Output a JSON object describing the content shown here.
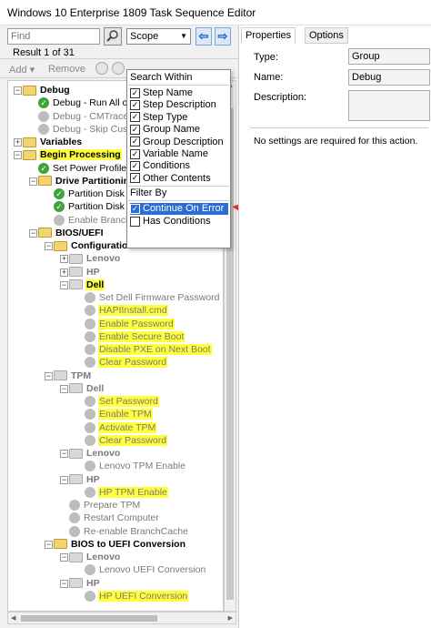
{
  "window": {
    "title": "Windows 10 Enterprise 1809 Task Sequence Editor"
  },
  "search": {
    "placeholder": "Find",
    "scope_label": "Scope",
    "result": "Result 1 of 31"
  },
  "toolbar": {
    "add_label": "Add",
    "remove_label": "Remove"
  },
  "scope_menu": {
    "search_within_header": "Search Within",
    "search_within": [
      {
        "label": "Step Name",
        "checked": true
      },
      {
        "label": "Step Description",
        "checked": true
      },
      {
        "label": "Step Type",
        "checked": true
      },
      {
        "label": "Group Name",
        "checked": true
      },
      {
        "label": "Group Description",
        "checked": true
      },
      {
        "label": "Variable Name",
        "checked": true
      },
      {
        "label": "Conditions",
        "checked": true
      },
      {
        "label": "Other Contents",
        "checked": true
      }
    ],
    "filter_by_header": "Filter By",
    "filter_by": [
      {
        "label": "Continue On Error",
        "checked": true,
        "selected": true
      },
      {
        "label": "Has Conditions",
        "checked": false,
        "selected": false
      }
    ]
  },
  "tree": [
    {
      "label": "Debug",
      "kind": "group",
      "level": 0,
      "exp": "-"
    },
    {
      "label": "Debug - Run All or",
      "kind": "ok",
      "level": 1
    },
    {
      "label": "Debug - CMTrace",
      "kind": "off",
      "level": 1
    },
    {
      "label": "Debug - Skip Cust",
      "kind": "off",
      "level": 1
    },
    {
      "label": "Variables",
      "kind": "group",
      "level": 0,
      "exp": "+"
    },
    {
      "label": "Begin Processing",
      "kind": "group",
      "level": 0,
      "exp": "-",
      "hl": true
    },
    {
      "label": "Set Power Profile t",
      "kind": "ok",
      "level": 1
    },
    {
      "label": "Drive Partitionin",
      "kind": "group",
      "level": 1,
      "exp": "-"
    },
    {
      "label": "Partition Disk 0",
      "kind": "ok",
      "level": 2
    },
    {
      "label": "Partition Disk 0",
      "kind": "ok",
      "level": 2
    },
    {
      "label": "Enable Branch",
      "kind": "off",
      "level": 2
    },
    {
      "label": "BIOS/UEFI",
      "kind": "group",
      "level": 1,
      "exp": "-"
    },
    {
      "label": "Configuration",
      "kind": "group",
      "level": 2,
      "exp": "-"
    },
    {
      "label": "Lenovo",
      "kind": "dgroup",
      "level": 3,
      "exp": "+"
    },
    {
      "label": "HP",
      "kind": "dgroup",
      "level": 3,
      "exp": "+"
    },
    {
      "label": "Dell",
      "kind": "dgroup",
      "level": 3,
      "exp": "-",
      "hl": true
    },
    {
      "label": "Set Dell Firmware Password",
      "kind": "off",
      "level": 4
    },
    {
      "label": "HAPIInstall.cmd",
      "kind": "off",
      "level": 4,
      "hl": true
    },
    {
      "label": "Enable Password",
      "kind": "off",
      "level": 4,
      "hl": true
    },
    {
      "label": "Enable Secure Boot",
      "kind": "off",
      "level": 4,
      "hl": true
    },
    {
      "label": "Disable PXE on Next Boot",
      "kind": "off",
      "level": 4,
      "hl": true
    },
    {
      "label": "Clear Password",
      "kind": "off",
      "level": 4,
      "hl": true
    },
    {
      "label": "TPM",
      "kind": "dgroup",
      "level": 2,
      "exp": "-"
    },
    {
      "label": "Dell",
      "kind": "dgroup",
      "level": 3,
      "exp": "-"
    },
    {
      "label": "Set Password",
      "kind": "off",
      "level": 4,
      "hl": true
    },
    {
      "label": "Enable TPM",
      "kind": "off",
      "level": 4,
      "hl": true
    },
    {
      "label": "Activate TPM",
      "kind": "off",
      "level": 4,
      "hl": true
    },
    {
      "label": "Clear Password",
      "kind": "off",
      "level": 4,
      "hl": true
    },
    {
      "label": "Lenovo",
      "kind": "dgroup",
      "level": 3,
      "exp": "-"
    },
    {
      "label": "Lenovo TPM Enable",
      "kind": "off",
      "level": 4
    },
    {
      "label": "HP",
      "kind": "dgroup",
      "level": 3,
      "exp": "-"
    },
    {
      "label": "HP TPM Enable",
      "kind": "off",
      "level": 4,
      "hl": true
    },
    {
      "label": "Prepare TPM",
      "kind": "off",
      "level": 3
    },
    {
      "label": "Restart Computer",
      "kind": "off",
      "level": 3
    },
    {
      "label": "Re-enable BranchCache",
      "kind": "off",
      "level": 3
    },
    {
      "label": "BIOS to UEFI Conversion",
      "kind": "group",
      "level": 2,
      "exp": "-"
    },
    {
      "label": "Lenovo",
      "kind": "dgroup",
      "level": 3,
      "exp": "-"
    },
    {
      "label": "Lenovo UEFI Conversion",
      "kind": "off",
      "level": 4
    },
    {
      "label": "HP",
      "kind": "dgroup",
      "level": 3,
      "exp": "-"
    },
    {
      "label": "HP UEFI Conversion",
      "kind": "off",
      "level": 4,
      "hl": true
    }
  ],
  "tabs": [
    {
      "label": "Properties",
      "active": true
    },
    {
      "label": "Options",
      "active": false
    }
  ],
  "properties": {
    "type_label": "Type:",
    "type_value": "Group",
    "name_label": "Name:",
    "name_value": "Debug",
    "description_label": "Description:",
    "description_value": "",
    "note": "No settings are required  for this action."
  },
  "colors": {
    "highlight": "#ffff3b",
    "selection": "#2a6dd4",
    "arrow": "#e03030"
  }
}
